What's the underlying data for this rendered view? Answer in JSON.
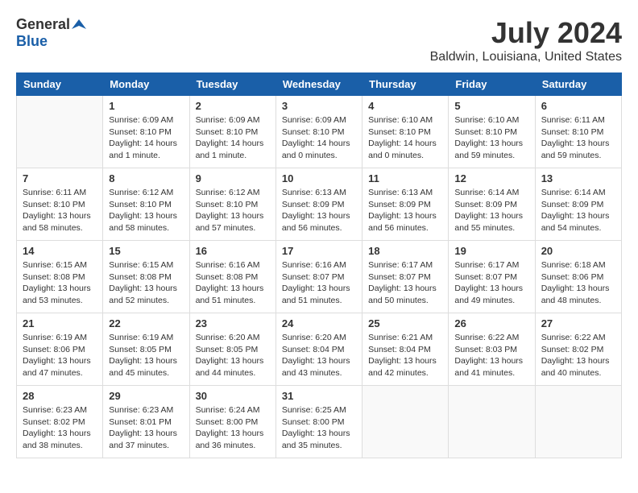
{
  "logo": {
    "general": "General",
    "blue": "Blue"
  },
  "header": {
    "title": "July 2024",
    "subtitle": "Baldwin, Louisiana, United States"
  },
  "calendar": {
    "days_of_week": [
      "Sunday",
      "Monday",
      "Tuesday",
      "Wednesday",
      "Thursday",
      "Friday",
      "Saturday"
    ],
    "weeks": [
      [
        {
          "day": "",
          "info": ""
        },
        {
          "day": "1",
          "info": "Sunrise: 6:09 AM\nSunset: 8:10 PM\nDaylight: 14 hours\nand 1 minute."
        },
        {
          "day": "2",
          "info": "Sunrise: 6:09 AM\nSunset: 8:10 PM\nDaylight: 14 hours\nand 1 minute."
        },
        {
          "day": "3",
          "info": "Sunrise: 6:09 AM\nSunset: 8:10 PM\nDaylight: 14 hours\nand 0 minutes."
        },
        {
          "day": "4",
          "info": "Sunrise: 6:10 AM\nSunset: 8:10 PM\nDaylight: 14 hours\nand 0 minutes."
        },
        {
          "day": "5",
          "info": "Sunrise: 6:10 AM\nSunset: 8:10 PM\nDaylight: 13 hours\nand 59 minutes."
        },
        {
          "day": "6",
          "info": "Sunrise: 6:11 AM\nSunset: 8:10 PM\nDaylight: 13 hours\nand 59 minutes."
        }
      ],
      [
        {
          "day": "7",
          "info": "Sunrise: 6:11 AM\nSunset: 8:10 PM\nDaylight: 13 hours\nand 58 minutes."
        },
        {
          "day": "8",
          "info": "Sunrise: 6:12 AM\nSunset: 8:10 PM\nDaylight: 13 hours\nand 58 minutes."
        },
        {
          "day": "9",
          "info": "Sunrise: 6:12 AM\nSunset: 8:10 PM\nDaylight: 13 hours\nand 57 minutes."
        },
        {
          "day": "10",
          "info": "Sunrise: 6:13 AM\nSunset: 8:09 PM\nDaylight: 13 hours\nand 56 minutes."
        },
        {
          "day": "11",
          "info": "Sunrise: 6:13 AM\nSunset: 8:09 PM\nDaylight: 13 hours\nand 56 minutes."
        },
        {
          "day": "12",
          "info": "Sunrise: 6:14 AM\nSunset: 8:09 PM\nDaylight: 13 hours\nand 55 minutes."
        },
        {
          "day": "13",
          "info": "Sunrise: 6:14 AM\nSunset: 8:09 PM\nDaylight: 13 hours\nand 54 minutes."
        }
      ],
      [
        {
          "day": "14",
          "info": "Sunrise: 6:15 AM\nSunset: 8:08 PM\nDaylight: 13 hours\nand 53 minutes."
        },
        {
          "day": "15",
          "info": "Sunrise: 6:15 AM\nSunset: 8:08 PM\nDaylight: 13 hours\nand 52 minutes."
        },
        {
          "day": "16",
          "info": "Sunrise: 6:16 AM\nSunset: 8:08 PM\nDaylight: 13 hours\nand 51 minutes."
        },
        {
          "day": "17",
          "info": "Sunrise: 6:16 AM\nSunset: 8:07 PM\nDaylight: 13 hours\nand 51 minutes."
        },
        {
          "day": "18",
          "info": "Sunrise: 6:17 AM\nSunset: 8:07 PM\nDaylight: 13 hours\nand 50 minutes."
        },
        {
          "day": "19",
          "info": "Sunrise: 6:17 AM\nSunset: 8:07 PM\nDaylight: 13 hours\nand 49 minutes."
        },
        {
          "day": "20",
          "info": "Sunrise: 6:18 AM\nSunset: 8:06 PM\nDaylight: 13 hours\nand 48 minutes."
        }
      ],
      [
        {
          "day": "21",
          "info": "Sunrise: 6:19 AM\nSunset: 8:06 PM\nDaylight: 13 hours\nand 47 minutes."
        },
        {
          "day": "22",
          "info": "Sunrise: 6:19 AM\nSunset: 8:05 PM\nDaylight: 13 hours\nand 45 minutes."
        },
        {
          "day": "23",
          "info": "Sunrise: 6:20 AM\nSunset: 8:05 PM\nDaylight: 13 hours\nand 44 minutes."
        },
        {
          "day": "24",
          "info": "Sunrise: 6:20 AM\nSunset: 8:04 PM\nDaylight: 13 hours\nand 43 minutes."
        },
        {
          "day": "25",
          "info": "Sunrise: 6:21 AM\nSunset: 8:04 PM\nDaylight: 13 hours\nand 42 minutes."
        },
        {
          "day": "26",
          "info": "Sunrise: 6:22 AM\nSunset: 8:03 PM\nDaylight: 13 hours\nand 41 minutes."
        },
        {
          "day": "27",
          "info": "Sunrise: 6:22 AM\nSunset: 8:02 PM\nDaylight: 13 hours\nand 40 minutes."
        }
      ],
      [
        {
          "day": "28",
          "info": "Sunrise: 6:23 AM\nSunset: 8:02 PM\nDaylight: 13 hours\nand 38 minutes."
        },
        {
          "day": "29",
          "info": "Sunrise: 6:23 AM\nSunset: 8:01 PM\nDaylight: 13 hours\nand 37 minutes."
        },
        {
          "day": "30",
          "info": "Sunrise: 6:24 AM\nSunset: 8:00 PM\nDaylight: 13 hours\nand 36 minutes."
        },
        {
          "day": "31",
          "info": "Sunrise: 6:25 AM\nSunset: 8:00 PM\nDaylight: 13 hours\nand 35 minutes."
        },
        {
          "day": "",
          "info": ""
        },
        {
          "day": "",
          "info": ""
        },
        {
          "day": "",
          "info": ""
        }
      ]
    ]
  }
}
